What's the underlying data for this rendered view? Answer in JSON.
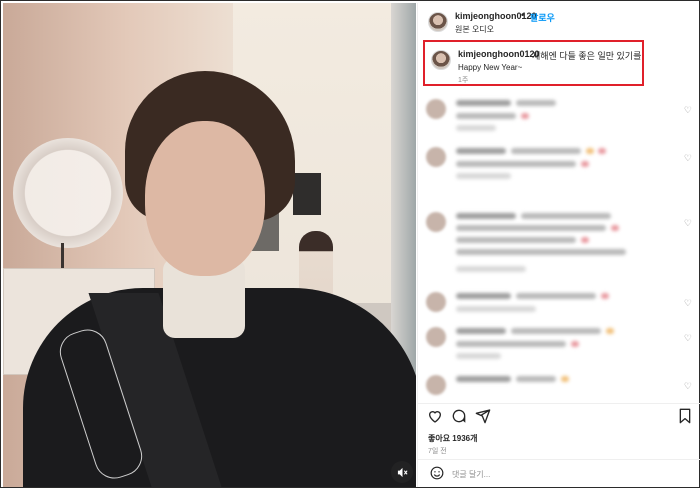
{
  "post": {
    "username": "kimjeonghoon0120",
    "separator": "•",
    "follow_label": "팔로우",
    "audio": "원본 오디오",
    "caption_text": "새해엔 다들 좋은 일만 있기를",
    "caption_line2": "Happy New Year~",
    "caption_time": "1주",
    "likes": "좋아요 1936개",
    "posted": "7일 전",
    "comment_placeholder": "댓글 달기...",
    "icons": {
      "like": "heart-icon",
      "comment": "comment-icon",
      "share": "share-icon",
      "save": "bookmark-icon",
      "emoji": "emoji-icon",
      "more": "more-icon",
      "mute": "speaker-icon"
    },
    "highlight_color": "#e0202a",
    "link_color": "#0095f6"
  }
}
